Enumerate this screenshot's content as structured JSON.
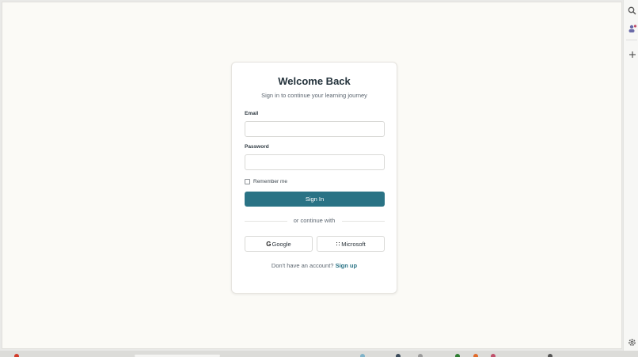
{
  "login": {
    "title": "Welcome Back",
    "subtitle": "Sign in to continue your learning journey",
    "email_label": "Email",
    "email_value": "",
    "password_label": "Password",
    "password_value": "",
    "remember_label": "Remember me",
    "remember_checked": false,
    "signin_label": "Sign In",
    "divider_text": "or continue with",
    "google_label": "Google",
    "google_icon": "G",
    "microsoft_label": "Microsoft",
    "signup_prompt": "Don't have an account?",
    "signup_link": "Sign up"
  },
  "rail": {
    "icons": [
      "search-icon",
      "profile-icon",
      "plus-icon",
      "settings-icon"
    ]
  },
  "colors": {
    "accent": "#2a7385",
    "title": "#23323b",
    "background": "#fbfaf6"
  }
}
